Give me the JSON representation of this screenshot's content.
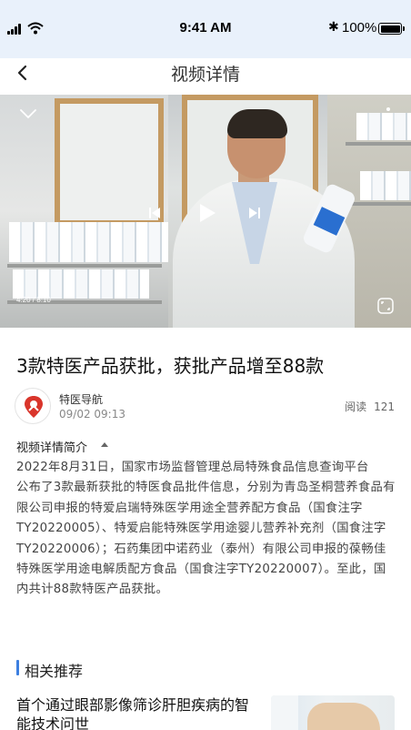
{
  "status": {
    "time": "9:41 AM",
    "battery_pct": "100%"
  },
  "nav": {
    "title": "视频详情"
  },
  "video": {
    "progress_text": "4:20 / 8:10"
  },
  "article": {
    "title": "3款特医产品获批，获批产品增至88款",
    "source_name": "特医导航",
    "date": "09/02  09:13",
    "reads_label": "阅读",
    "reads_count": "121",
    "intro_label": "视频详情简介",
    "paragraphs": [
      "2022年8月31日，国家市场监督管理总局特殊食品信息查询平台",
      "公布了3款最新获批的特医食品批件信息，分别为青岛圣桐营养食品有限公司申报的特爱启瑞特殊医学用途全营养配方食品（国食注字TY20220005）、特爱启能特殊医学用途婴儿营养补充剂（国食注字TY20220006）；石药集团中诺药业（泰州）有限公司申报的葆畅佳特殊医学用途电解质配方食品（国食注字TY20220007）。至此，国内共计88款特医产品获批。"
    ]
  },
  "related": {
    "title": "相关推荐",
    "items": [
      {
        "title": "首个通过眼部影像筛诊肝胆疾病的智能技术问世"
      }
    ]
  },
  "colors": {
    "status_bg": "#e9f1fb",
    "accent": "#3c7fe0",
    "logo_red": "#d9352b"
  }
}
